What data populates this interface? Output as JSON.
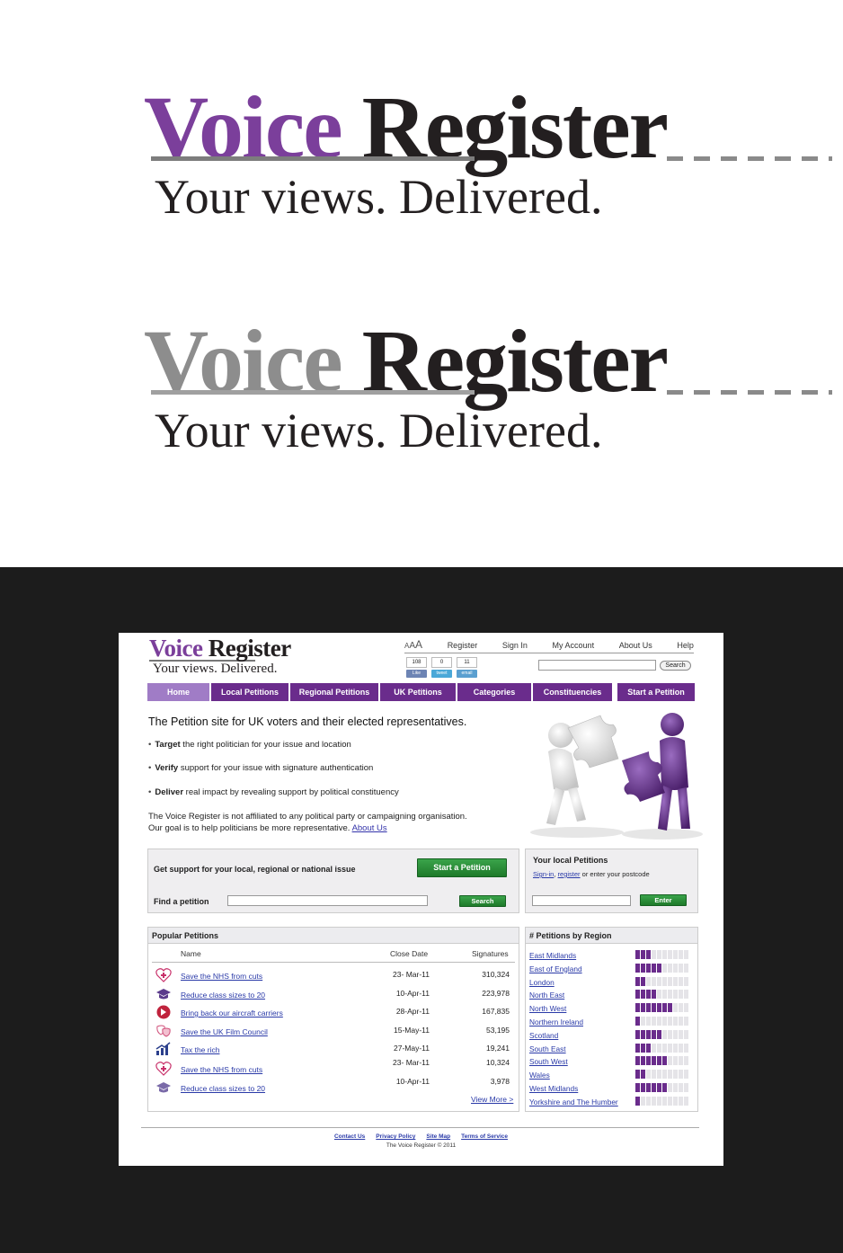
{
  "logo": {
    "word1": "Voice",
    "word2": "Register",
    "tagline": "Your views. Delivered."
  },
  "colors": {
    "purple": "#7b3f9b",
    "nav_purple": "#6a2c8c",
    "nav_active": "#a07cc6",
    "green": "#2a8f38",
    "dark_background": "#1c1c1c"
  },
  "mockup": {
    "logo": {
      "word1": "Voice",
      "word2": "Register",
      "tagline": "Your views. Delivered."
    },
    "text_size": {
      "small": "A",
      "medium": "A",
      "large": "A"
    },
    "top_links": [
      "Register",
      "Sign In",
      "My Account",
      "About Us",
      "Help"
    ],
    "social": [
      {
        "count": "108",
        "label": "Like",
        "icon": "facebook-like-icon"
      },
      {
        "count": "0",
        "label": "tweet",
        "icon": "twitter-icon"
      },
      {
        "count": "11",
        "label": "email",
        "icon": "email-icon"
      }
    ],
    "search_button": "Search",
    "nav": [
      "Home",
      "Local Petitions",
      "Regional Petitions",
      "UK Petitions",
      "Categories",
      "Constituencies",
      "Start a Petition"
    ],
    "intro": {
      "heading": "The Petition site for UK voters and their elected representatives.",
      "bullets": [
        {
          "bold": "Target",
          "text": " the right politician for your issue and location"
        },
        {
          "bold": "Verify",
          "text": " support for your issue with signature authentication"
        },
        {
          "bold": "Deliver",
          "text": " real impact by revealing support by political constituency"
        }
      ],
      "disclaimer_1": "The Voice Register is not affiliated to any political party or campaigning organisation.",
      "disclaimer_2": "Our goal is to help politicians be more representative.",
      "about_link": "About Us"
    },
    "support_box": {
      "text": "Get support for your local, regional or national issue",
      "start_button": "Start a Petition",
      "find_label": "Find a petition",
      "search_button": "Search"
    },
    "local_box": {
      "title": "Your local Petitions",
      "signin": "Sign-in",
      "comma": ",",
      "register": "register",
      "rest": " or enter your postcode",
      "enter_button": "Enter"
    },
    "popular": {
      "title": "Popular Petitions",
      "col_name": "Name",
      "col_date": "Close Date",
      "col_signatures": "Signatures",
      "rows": [
        {
          "icon": "health-heart-icon",
          "name": "Save the NHS from cuts",
          "date": "23- Mar-11",
          "signatures": "310,324"
        },
        {
          "icon": "education-cap-icon",
          "name": "Reduce class sizes to 20",
          "date": "10-Apr-11",
          "signatures": "223,978"
        },
        {
          "icon": "defence-icon",
          "name": "Bring back our aircraft carriers",
          "date": "28-Apr-11",
          "signatures": "167,835"
        },
        {
          "icon": "arts-theatre-icon",
          "name": "Save the UK Film Council",
          "date": "15-May-11",
          "signatures": "53,195"
        },
        {
          "icon": "economy-chart-icon",
          "name": "Tax the rich",
          "date": "27-May-11",
          "signatures": "19,241"
        },
        {
          "icon": "health-heart-icon",
          "name": "Save the NHS from cuts",
          "date": "23- Mar-11",
          "signatures": "10,324"
        },
        {
          "icon": "education-cap-icon",
          "name": "Reduce class sizes to 20",
          "date": "10-Apr-11",
          "signatures": "3,978"
        }
      ],
      "view_more": "View More >"
    },
    "regions": {
      "title": "# Petitions by Region",
      "rows": [
        {
          "name": "East Midlands",
          "level": 3
        },
        {
          "name": "East of England",
          "level": 5
        },
        {
          "name": "London",
          "level": 2
        },
        {
          "name": "North East",
          "level": 4
        },
        {
          "name": "North West",
          "level": 7
        },
        {
          "name": "Northern Ireland",
          "level": 1
        },
        {
          "name": "Scotland",
          "level": 5
        },
        {
          "name": "South East",
          "level": 3
        },
        {
          "name": "South West",
          "level": 6
        },
        {
          "name": "Wales",
          "level": 2
        },
        {
          "name": "West Midlands",
          "level": 6
        },
        {
          "name": "Yorkshire and The Humber",
          "level": 1
        }
      ]
    },
    "footer": {
      "links": [
        "Contact Us",
        "Privacy Policy",
        "Site Map",
        "Terms of Service"
      ],
      "copyright": "The Voice Register © 2011"
    }
  }
}
